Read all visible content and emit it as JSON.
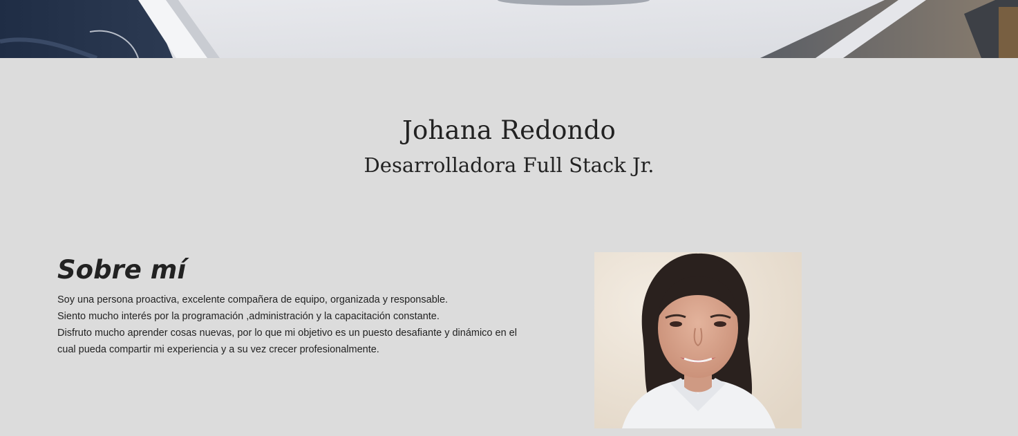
{
  "profile": {
    "name": "Johana Redondo",
    "role": "Desarrolladora Full Stack Jr."
  },
  "about": {
    "title": "Sobre mí",
    "lines": [
      "Soy una persona proactiva, excelente compañera de equipo, organizada y responsable.",
      "Siento mucho interés por la programación ,administración y la capacitación constante.",
      "Disfruto mucho aprender cosas nuevas, por lo que mi objetivo es un puesto desafiante y dinámico en el",
      "cual pueda compartir mi experiencia y a su vez crecer profesionalmente."
    ]
  },
  "colors": {
    "page_background": "#dcdcdc",
    "text": "#222222"
  }
}
